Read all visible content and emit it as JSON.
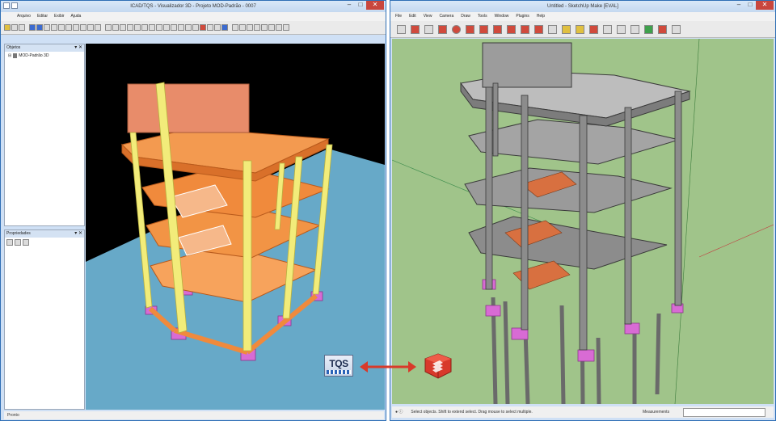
{
  "left_window": {
    "title": "ICAD/TQS - Visualizador 3D - Projeto MOD-Padrão - 0007",
    "menu": [
      "Arquivo",
      "Editar",
      "Exibir",
      "Ajuda"
    ],
    "tree_panel": {
      "title": "Objetos",
      "root_item": "MOD-Padrão 3D"
    },
    "properties_panel": {
      "title": "Propriedades"
    },
    "status": "Pronto"
  },
  "right_window": {
    "title": "Untitled - SketchUp Make [EVAL]",
    "menu": [
      "File",
      "Edit",
      "View",
      "Camera",
      "Draw",
      "Tools",
      "Window",
      "Plugins",
      "Help"
    ],
    "status": "Select objects. Shift to extend select. Drag mouse to select multiple.",
    "measurements_label": "Measurements"
  },
  "logos": {
    "left": "TQS",
    "right": "SketchUp"
  },
  "colors": {
    "slab_orange": "#f08a3c",
    "column_yellow": "#f2ec7a",
    "footing_magenta": "#d86bd4",
    "ground_blue": "#67a9c8",
    "sketchup_bg": "#a0c48a",
    "concrete_gray": "#8c8c8c",
    "arrow_red": "#d83a2a"
  }
}
